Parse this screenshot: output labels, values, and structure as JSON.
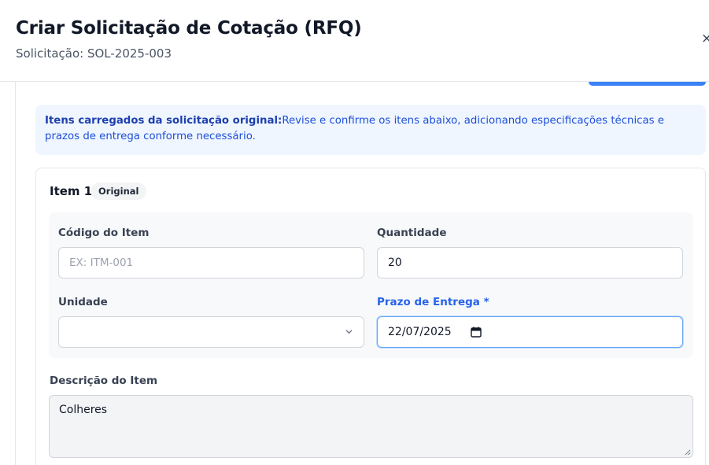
{
  "modal": {
    "title": "Criar Solicitação de Cotação (RFQ)",
    "subtitle": "Solicitação: SOL-2025-003",
    "close_icon": "×"
  },
  "info": {
    "bold": "Itens carregados da solicitação original:",
    "text": "Revise e confirme os itens abaixo, adicionando especificações técnicas e prazos de entrega conforme necessário."
  },
  "item": {
    "title": "Item 1",
    "badge": "Original",
    "code_label": "Código do Item",
    "code_placeholder": "EX: ITM-001",
    "quantity_label": "Quantidade",
    "quantity_value": "20",
    "unit_label": "Unidade",
    "unit_value": "",
    "deadline_label": "Prazo de Entrega *",
    "deadline_value": "22/07/2025",
    "description_label": "Descrição do Item",
    "description_value": "Colheres"
  },
  "colors": {
    "accent": "#3b82f6",
    "info_bg": "#eff6ff",
    "info_text": "#1d4ed8"
  },
  "icons": {
    "close": "close-icon",
    "chevron": "chevron-down-icon",
    "calendar": "calendar-icon",
    "resize": "resize-handle-icon"
  }
}
